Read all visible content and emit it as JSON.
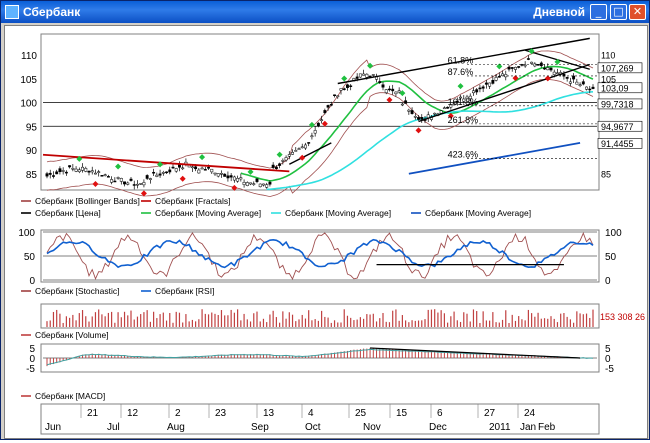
{
  "window": {
    "title": "Сбербанк",
    "timeframe": "Дневной",
    "buttons": {
      "minimize": "_",
      "maximize": "□",
      "close": "✕"
    }
  },
  "chart_data": [
    {
      "type": "candlestick",
      "panel": "price",
      "y_ticks": [
        85,
        90,
        95,
        100,
        105,
        110
      ],
      "ylim": [
        82,
        114
      ],
      "price_labels": [
        "107,269",
        "105",
        "103,09",
        "110",
        "99,7318",
        "94,9677",
        "91,4455",
        "85"
      ],
      "fib_labels": [
        "61.8%",
        "161.8%",
        "261.8%",
        "423.6%",
        "87.6%"
      ],
      "legend": [
        {
          "name": "Сбербанк [Bollinger Bands]",
          "color": "#a04040"
        },
        {
          "name": "Сбербанк [Fractals]",
          "color": "#c00000"
        },
        {
          "name": "Сбербанк [Цена]",
          "color": "#000000"
        },
        {
          "name": "Сбербанк [Moving Average]",
          "color": "#20c040"
        },
        {
          "name": "Сбербанк [Moving Average]",
          "color": "#30e0e0"
        },
        {
          "name": "Сбербанк [Moving Average]",
          "color": "#1050c0"
        }
      ]
    },
    {
      "type": "line",
      "panel": "oscillators",
      "y_ticks": [
        0,
        50,
        100
      ],
      "ylim": [
        0,
        100
      ],
      "legend": [
        {
          "name": "Сбербанк [Stochastic]",
          "color": "#a04040"
        },
        {
          "name": "Сбербанк [RSI]",
          "color": "#1060d0"
        }
      ]
    },
    {
      "type": "bar",
      "panel": "volume",
      "last_value_label": "153 308 26",
      "legend": [
        {
          "name": "Сбербанк [Volume]",
          "color": "#c04040"
        }
      ]
    },
    {
      "type": "bar",
      "panel": "macd",
      "y_ticks": [
        5,
        0,
        -5
      ],
      "ylim": [
        -6,
        6
      ],
      "legend": [
        {
          "name": "Сбербанк [MACD]",
          "color": "#c04040"
        }
      ]
    }
  ],
  "x_axis": {
    "day_labels": [
      "21",
      "12",
      "2",
      "23",
      "13",
      "4",
      "25",
      "15",
      "6",
      "27",
      "24"
    ],
    "month_labels": [
      "Jun",
      "Jul",
      "Aug",
      "Sep",
      "Oct",
      "Nov",
      "Dec",
      "2011",
      "Jan",
      "Feb"
    ]
  }
}
